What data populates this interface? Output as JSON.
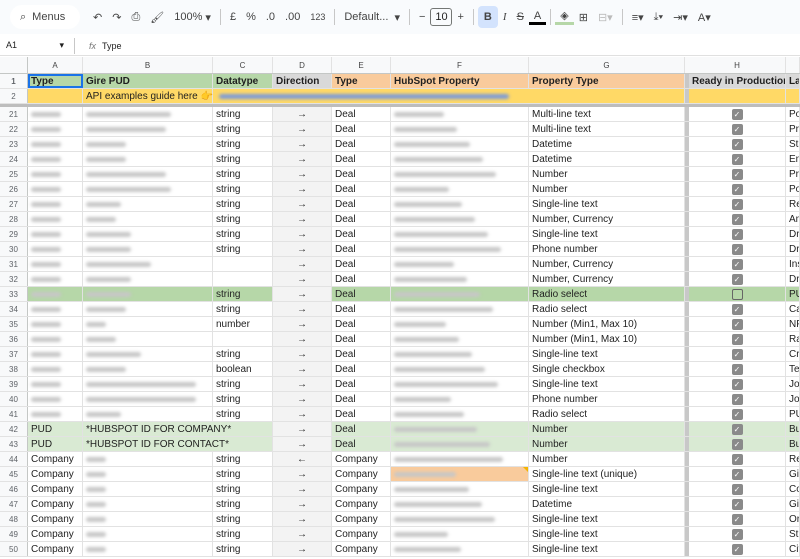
{
  "toolbar": {
    "menus_label": "Menus",
    "zoom": "100%",
    "currency": "£",
    "percent": "%",
    "dec_less": ".0",
    "dec_more": ".00",
    "format_123": "123",
    "font": "Default...",
    "font_size": "10",
    "minus": "−",
    "plus": "+",
    "bold": "B",
    "italic": "I",
    "strike": "S",
    "text_color": "A"
  },
  "formula_bar": {
    "cell_ref": "A1",
    "fx": "fx",
    "value": "Type"
  },
  "columns": [
    "A",
    "B",
    "C",
    "D",
    "E",
    "F",
    "G",
    "H"
  ],
  "header_row": {
    "num": "1",
    "A": "Type",
    "B": "Gire PUD",
    "C": "Datatype",
    "D": "Direction",
    "E": "Type",
    "F": "HubSpot Property",
    "G": "Property Type",
    "H": "Ready in Production",
    "I": "Lab"
  },
  "row2": {
    "num": "2",
    "B": "API examples guide here 👉"
  },
  "rows": [
    {
      "num": "21",
      "A": "",
      "B": "",
      "C": "string",
      "D": "→",
      "E": "Deal",
      "G": "Multi-line text",
      "checked": true,
      "I": "Pos",
      "style": ""
    },
    {
      "num": "22",
      "C": "string",
      "D": "→",
      "E": "Deal",
      "G": "Multi-line text",
      "checked": true,
      "I": "Pre",
      "style": ""
    },
    {
      "num": "23",
      "C": "string",
      "D": "→",
      "E": "Deal",
      "G": "Datetime",
      "checked": true,
      "I": "Sta",
      "style": ""
    },
    {
      "num": "24",
      "C": "string",
      "D": "→",
      "E": "Deal",
      "G": "Datetime",
      "checked": true,
      "I": "End",
      "style": ""
    },
    {
      "num": "25",
      "C": "string",
      "D": "→",
      "E": "Deal",
      "G": "Number",
      "checked": true,
      "I": "Pre",
      "style": ""
    },
    {
      "num": "26",
      "C": "string",
      "D": "→",
      "E": "Deal",
      "G": "Number",
      "checked": true,
      "I": "Pos",
      "style": ""
    },
    {
      "num": "27",
      "C": "string",
      "D": "→",
      "E": "Deal",
      "G": "Single-line text",
      "checked": true,
      "I": "Re",
      "style": ""
    },
    {
      "num": "28",
      "C": "string",
      "D": "→",
      "E": "Deal",
      "G": "Number, Currency",
      "checked": true,
      "I": "Am",
      "style": ""
    },
    {
      "num": "29",
      "C": "string",
      "D": "→",
      "E": "Deal",
      "G": "Single-line text",
      "checked": true,
      "I": "Dri",
      "style": ""
    },
    {
      "num": "30",
      "C": "string",
      "D": "→",
      "E": "Deal",
      "G": "Phone number",
      "checked": true,
      "I": "Dri",
      "style": ""
    },
    {
      "num": "31",
      "C": "",
      "D": "→",
      "E": "Deal",
      "G": "Number, Currency",
      "checked": true,
      "I": "Ins",
      "style": ""
    },
    {
      "num": "32",
      "C": "",
      "D": "→",
      "E": "Deal",
      "G": "Number, Currency",
      "checked": true,
      "I": "Dri",
      "style": ""
    },
    {
      "num": "33",
      "C": "string",
      "D": "→",
      "E": "Deal",
      "G": "Radio select",
      "checked": false,
      "I": "PU",
      "style": "green"
    },
    {
      "num": "34",
      "C": "string",
      "D": "→",
      "E": "Deal",
      "G": "Radio select",
      "checked": true,
      "I": "Cat",
      "style": ""
    },
    {
      "num": "35",
      "C": "number",
      "D": "→",
      "E": "Deal",
      "G": "Number (Min1, Max 10)",
      "checked": true,
      "I": "NP",
      "style": ""
    },
    {
      "num": "36",
      "C": "",
      "D": "→",
      "E": "Deal",
      "G": "Number (Min1, Max 10)",
      "checked": true,
      "I": "Ra",
      "style": ""
    },
    {
      "num": "37",
      "C": "string",
      "D": "→",
      "E": "Deal",
      "G": "Single-line text",
      "checked": true,
      "I": "Cre",
      "style": ""
    },
    {
      "num": "38",
      "C": "boolean",
      "D": "→",
      "E": "Deal",
      "G": "Single checkbox",
      "checked": true,
      "I": "Tes",
      "style": ""
    },
    {
      "num": "39",
      "C": "string",
      "D": "→",
      "E": "Deal",
      "G": "Single-line text",
      "checked": true,
      "I": "Job",
      "style": ""
    },
    {
      "num": "40",
      "C": "string",
      "D": "→",
      "E": "Deal",
      "G": "Phone number",
      "checked": true,
      "I": "Job",
      "style": ""
    },
    {
      "num": "41",
      "C": "string",
      "D": "→",
      "E": "Deal",
      "G": "Radio select",
      "checked": true,
      "I": "PU",
      "style": ""
    },
    {
      "num": "42",
      "A": "PUD",
      "B": "*HUBSPOT ID FOR COMPANY*",
      "C": "",
      "D": "→",
      "E": "Deal",
      "G": "Number",
      "checked": true,
      "I": "Buy",
      "style": "ltgreen"
    },
    {
      "num": "43",
      "A": "PUD",
      "B": "*HUBSPOT ID FOR CONTACT*",
      "C": "",
      "D": "→",
      "E": "Deal",
      "G": "Number",
      "checked": true,
      "I": "Buy",
      "style": "ltgreen"
    },
    {
      "num": "44",
      "A": "Company",
      "C": "string",
      "D": "←",
      "E": "Company",
      "G": "Number",
      "checked": true,
      "I": "Re",
      "style": ""
    },
    {
      "num": "45",
      "A": "Company",
      "C": "string",
      "D": "→",
      "E": "Company",
      "G": "Single-line text (unique)",
      "checked": true,
      "I": "Gir",
      "style": "orangeF"
    },
    {
      "num": "46",
      "A": "Company",
      "C": "string",
      "D": "→",
      "E": "Company",
      "G": "Single-line text",
      "checked": true,
      "I": "Co",
      "style": ""
    },
    {
      "num": "47",
      "A": "Company",
      "C": "string",
      "D": "→",
      "E": "Company",
      "G": "Datetime",
      "checked": true,
      "I": "Gir",
      "style": ""
    },
    {
      "num": "48",
      "A": "Company",
      "C": "string",
      "D": "→",
      "E": "Company",
      "G": "Single-line text",
      "checked": true,
      "I": "Org",
      "style": ""
    },
    {
      "num": "49",
      "A": "Company",
      "C": "string",
      "D": "→",
      "E": "Company",
      "G": "Single-line text",
      "checked": true,
      "I": "Str",
      "style": ""
    },
    {
      "num": "50",
      "A": "Company",
      "C": "string",
      "D": "→",
      "E": "Company",
      "G": "Single-line text",
      "checked": true,
      "I": "Cit",
      "style": ""
    }
  ]
}
